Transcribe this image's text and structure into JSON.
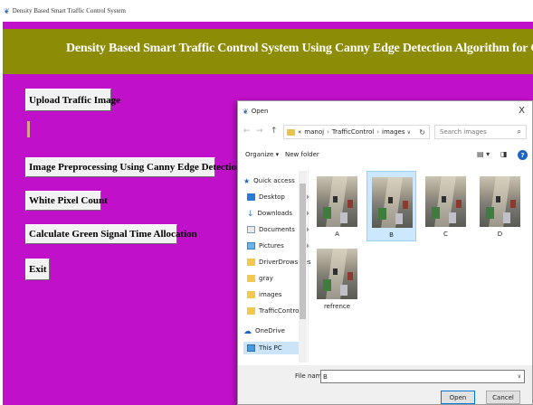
{
  "app": {
    "window_title": "Density Based Smart Traffic Control System",
    "banner_title": "Density Based Smart Traffic Control System Using Canny Edge Detection Algorithm for Congregating Traffic Information",
    "buttons": {
      "upload": "Upload Traffic Image",
      "preprocess": "Image Preprocessing Using Canny Edge Detection",
      "white_pixel": "White Pixel Count",
      "green_time": "Calculate Green Signal Time Allocation",
      "exit": "Exit"
    },
    "colors": {
      "background": "#c110c9",
      "banner": "#8c8c06"
    }
  },
  "dialog": {
    "title": "Open",
    "close": "X",
    "nav_back": "←",
    "nav_forward": "→",
    "nav_up": "↑",
    "address": {
      "overflow": "«",
      "parts": [
        "manoj",
        "TrafficControl",
        "images"
      ]
    },
    "search_placeholder": "Search images",
    "toolbar": {
      "organize": "Organize ▾",
      "new_folder": "New folder"
    },
    "nav_items": [
      {
        "label": "Quick access",
        "icon": "star-icon"
      },
      {
        "label": "Desktop",
        "icon": "desktop-icon"
      },
      {
        "label": "Downloads",
        "icon": "download-icon"
      },
      {
        "label": "Documents",
        "icon": "documents-icon"
      },
      {
        "label": "Pictures",
        "icon": "pictures-icon"
      },
      {
        "label": "DriverDrowsines",
        "icon": "folder-icon"
      },
      {
        "label": "gray",
        "icon": "folder-icon"
      },
      {
        "label": "images",
        "icon": "folder-icon"
      },
      {
        "label": "TrafficControl",
        "icon": "folder-icon"
      },
      {
        "label": "OneDrive",
        "icon": "cloud-icon"
      },
      {
        "label": "This PC",
        "icon": "computer-icon"
      }
    ],
    "files": [
      {
        "name": "A",
        "selected": false
      },
      {
        "name": "B",
        "selected": true
      },
      {
        "name": "C",
        "selected": false
      },
      {
        "name": "D",
        "selected": false
      },
      {
        "name": "refrence",
        "selected": false
      }
    ],
    "file_name_label": "File name:",
    "file_name_value": "B",
    "open_button": "Open",
    "cancel_button": "Cancel"
  }
}
